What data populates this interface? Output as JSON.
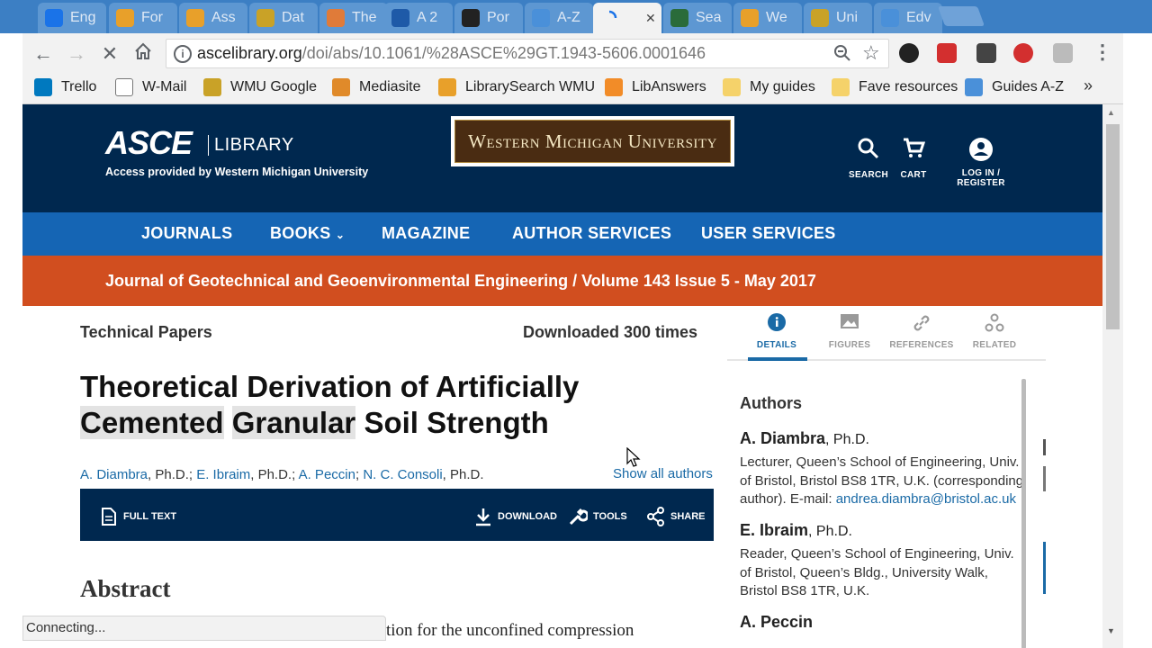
{
  "browser": {
    "tabs": [
      {
        "title": "Eng",
        "icon": "e-icon",
        "color": "#1a73e8"
      },
      {
        "title": "For",
        "icon": "rainbow-icon",
        "color": "#e8a02a"
      },
      {
        "title": "Ass",
        "icon": "rainbow-icon",
        "color": "#e8a02a"
      },
      {
        "title": "Dat",
        "icon": "w-gold-icon",
        "color": "#c9a227"
      },
      {
        "title": "The",
        "icon": "e-orange-icon",
        "color": "#e07b39"
      },
      {
        "title": "A 2",
        "icon": "ieee-icon",
        "color": "#1e5aa8"
      },
      {
        "title": "Por",
        "icon": "wiki-w-icon",
        "color": "#222222"
      },
      {
        "title": "A-Z",
        "icon": "cloud-icon",
        "color": "#4a90d9"
      },
      {
        "title": "",
        "icon": "loading-spinner-icon",
        "color": "#1a73e8"
      },
      {
        "title": "Sea",
        "icon": "aps-icon",
        "color": "#2a6b3a"
      },
      {
        "title": "We",
        "icon": "rainbow-icon",
        "color": "#e8a02a"
      },
      {
        "title": "Uni",
        "icon": "w-gold-icon",
        "color": "#c9a227"
      },
      {
        "title": "Edv",
        "icon": "cloud-icon",
        "color": "#4a90d9"
      }
    ],
    "url_domain": "ascelibrary.org",
    "url_path": "/doi/abs/10.1061/%28ASCE%29GT.1943-5606.0001646",
    "bookmarks": [
      {
        "label": "Trello",
        "icon": "trello-icon"
      },
      {
        "label": "W-Mail",
        "icon": "page-icon"
      },
      {
        "label": "WMU Google",
        "icon": "wmu-icon"
      },
      {
        "label": "Mediasite",
        "icon": "mediasite-icon"
      },
      {
        "label": "LibrarySearch WMU",
        "icon": "rainbow-icon"
      },
      {
        "label": "LibAnswers",
        "icon": "libanswers-icon"
      },
      {
        "label": "My guides",
        "icon": "folder-icon"
      },
      {
        "label": "Fave resources",
        "icon": "folder-icon"
      },
      {
        "label": "Guides A-Z",
        "icon": "cloud-icon"
      }
    ],
    "bookmarks_overflow": "»",
    "status_text": "Connecting..."
  },
  "header": {
    "logo": "ASCE",
    "logo_sub": "LIBRARY",
    "access_text": "Access provided by Western Michigan University",
    "institution_banner": "Western Michigan University",
    "search_label": "SEARCH",
    "cart_label": "CART",
    "login_label": "LOG IN / REGISTER"
  },
  "nav": {
    "journals": "JOURNALS",
    "books": "BOOKS",
    "magazine": "MAGAZINE",
    "author_services": "AUTHOR SERVICES",
    "user_services": "USER SERVICES"
  },
  "journal_bar": "Journal of Geotechnical and Geoenvironmental Engineering / Volume 143 Issue 5 - May 2017",
  "article": {
    "section": "Technical Papers",
    "downloads": "Downloaded 300 times",
    "title_line1": "Theoretical Derivation of Artificially",
    "title_w1": "Cemented",
    "title_w2": "Granular",
    "title_w3": "Soil Strength",
    "authors": [
      {
        "name": "A. Diambra",
        "suffix": ", Ph.D.; "
      },
      {
        "name": "E. Ibraim",
        "suffix": ", Ph.D.; "
      },
      {
        "name": "A. Peccin",
        "suffix": "; "
      },
      {
        "name": "N. C. Consoli",
        "suffix": ", Ph.D."
      }
    ],
    "show_all_authors": "Show all authors",
    "actions": {
      "full_text": "FULL TEXT",
      "download": "DOWNLOAD",
      "tools": "TOOLS",
      "share": "SHARE"
    },
    "abstract_heading": "Abstract",
    "abstract_visible": "tion for the unconfined compression"
  },
  "panel": {
    "tabs": {
      "details": "DETAILS",
      "figures": "FIGURES",
      "references": "REFERENCES",
      "related": "RELATED"
    },
    "authors_heading": "Authors",
    "author1_name": "A. Diambra",
    "author1_deg": ", Ph.D.",
    "author1_aff": "Lecturer, Queen’s School of Engineering, Univ. of Bristol, Bristol BS8 1TR, U.K. (corresponding author). E-mail: ",
    "author1_email": "andrea.diambra@bristol.ac.uk",
    "author2_name": "E. Ibraim",
    "author2_deg": ", Ph.D.",
    "author2_aff": "Reader, Queen’s School of Engineering, Univ. of Bristol, Queen’s Bldg., University Walk, Bristol BS8 1TR, U.K.",
    "author3_name": "A. Peccin"
  },
  "colors": {
    "header_bg": "#00284f",
    "nav_bg": "#1565b4",
    "journal_bar_bg": "#d14e1f",
    "link": "#1a6aa6"
  }
}
